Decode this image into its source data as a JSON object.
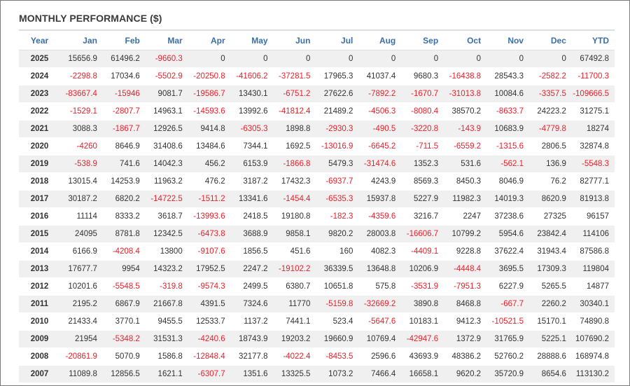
{
  "title": "MONTHLY PERFORMANCE ($)",
  "colors": {
    "header_text": "#3b6fa6",
    "negative": "#e8212b",
    "stripe": "#f0f0f0"
  },
  "columns": [
    "Year",
    "Jan",
    "Feb",
    "Mar",
    "Apr",
    "May",
    "Jun",
    "Jul",
    "Aug",
    "Sep",
    "Oct",
    "Nov",
    "Dec",
    "YTD"
  ],
  "rows": [
    [
      "2025",
      "15656.9",
      "61496.2",
      "-9660.3",
      "0",
      "0",
      "0",
      "0",
      "0",
      "0",
      "0",
      "0",
      "0",
      "67492.8"
    ],
    [
      "2024",
      "-2298.8",
      "17034.6",
      "-5502.9",
      "-20250.8",
      "-41606.2",
      "-37281.5",
      "17965.3",
      "41037.4",
      "9680.3",
      "-16438.8",
      "28543.3",
      "-2582.2",
      "-11700.3"
    ],
    [
      "2023",
      "-83667.4",
      "-15946",
      "9081.7",
      "-19586.7",
      "13430.1",
      "-6751.2",
      "27622.6",
      "-7892.2",
      "-1670.7",
      "-31013.8",
      "10084.6",
      "-3357.5",
      "-109666.5"
    ],
    [
      "2022",
      "-1529.1",
      "-2807.7",
      "14963.1",
      "-14593.6",
      "13992.6",
      "-41812.4",
      "21489.2",
      "-4506.3",
      "-8080.4",
      "38570.2",
      "-8633.7",
      "24223.2",
      "31275.1"
    ],
    [
      "2021",
      "3088.3",
      "-1867.7",
      "12926.5",
      "9414.8",
      "-6305.3",
      "1898.8",
      "-2930.3",
      "-490.5",
      "-3220.8",
      "-143.9",
      "10683.9",
      "-4779.8",
      "18274"
    ],
    [
      "2020",
      "-4260",
      "8646.9",
      "31408.6",
      "13484.6",
      "7344.1",
      "1692.5",
      "-13016.9",
      "-6645.2",
      "-711.5",
      "-6559.2",
      "-1315.6",
      "2806.5",
      "32874.8"
    ],
    [
      "2019",
      "-538.9",
      "741.6",
      "14042.3",
      "456.2",
      "6153.9",
      "-1866.8",
      "5479.3",
      "-31474.6",
      "1352.3",
      "531.6",
      "-562.1",
      "136.9",
      "-5548.3"
    ],
    [
      "2018",
      "13015.4",
      "14253.9",
      "11963.2",
      "476.2",
      "3187.2",
      "17432.3",
      "-6937.7",
      "4243.9",
      "8569.3",
      "8450.3",
      "8046.9",
      "76.2",
      "82777.1"
    ],
    [
      "2017",
      "30187.2",
      "6820.2",
      "-14722.5",
      "-1511.2",
      "13341.6",
      "-1454.4",
      "-6535.3",
      "15937.8",
      "5227.9",
      "11982.3",
      "14019.3",
      "8620.9",
      "81913.8"
    ],
    [
      "2016",
      "11114",
      "8333.2",
      "3618.7",
      "-13993.6",
      "2418.5",
      "19180.8",
      "-182.3",
      "-4359.6",
      "3216.7",
      "2247",
      "37238.6",
      "27325",
      "96157"
    ],
    [
      "2015",
      "24095",
      "8781.8",
      "12342.5",
      "-6473.8",
      "3688.9",
      "9858.1",
      "9820.2",
      "28003.8",
      "-16606.7",
      "10799.2",
      "5954.6",
      "23842.4",
      "114106"
    ],
    [
      "2014",
      "6166.9",
      "-4208.4",
      "13800",
      "-9107.6",
      "1856.5",
      "451.6",
      "160",
      "4082.3",
      "-4409.1",
      "9228.8",
      "37622.4",
      "31943.4",
      "87586.8"
    ],
    [
      "2013",
      "17677.7",
      "9954",
      "14323.2",
      "17952.5",
      "2247.2",
      "-19102.2",
      "36339.5",
      "13648.8",
      "10206.9",
      "-4448.4",
      "3695.5",
      "17309.3",
      "119804"
    ],
    [
      "2012",
      "10201.6",
      "-5548.5",
      "-319.8",
      "-9574.3",
      "2499.5",
      "6380.7",
      "10651.8",
      "575.8",
      "-3531.9",
      "-7951.3",
      "6227.9",
      "5265.5",
      "14877"
    ],
    [
      "2011",
      "2195.2",
      "6867.9",
      "21667.8",
      "4391.5",
      "7324.6",
      "11770",
      "-5159.8",
      "-32669.2",
      "3890.8",
      "8468.8",
      "-667.7",
      "2260.2",
      "30340.1"
    ],
    [
      "2010",
      "21433.4",
      "3770.1",
      "9455.5",
      "12533.7",
      "1137.2",
      "7441.1",
      "523.4",
      "-5647.6",
      "10183.1",
      "9412.3",
      "-10521.5",
      "15170.1",
      "74890.8"
    ],
    [
      "2009",
      "21954",
      "-5348.2",
      "31531.3",
      "-4240.6",
      "18743.9",
      "19203.2",
      "19660.9",
      "10769.4",
      "-42947.6",
      "1372.9",
      "31765.9",
      "5225.1",
      "107690.2"
    ],
    [
      "2008",
      "-20861.9",
      "5070.9",
      "1586.8",
      "-12848.4",
      "32177.8",
      "-4022.4",
      "-8453.5",
      "2596.6",
      "43693.9",
      "48386.2",
      "52760.2",
      "28888.6",
      "168974.8"
    ],
    [
      "2007",
      "11089.8",
      "12856.5",
      "1621.1",
      "-6307.7",
      "1351.6",
      "13325.5",
      "1073.2",
      "7466.4",
      "16658.1",
      "9620.2",
      "35720.9",
      "8654.6",
      "113130.2"
    ]
  ]
}
